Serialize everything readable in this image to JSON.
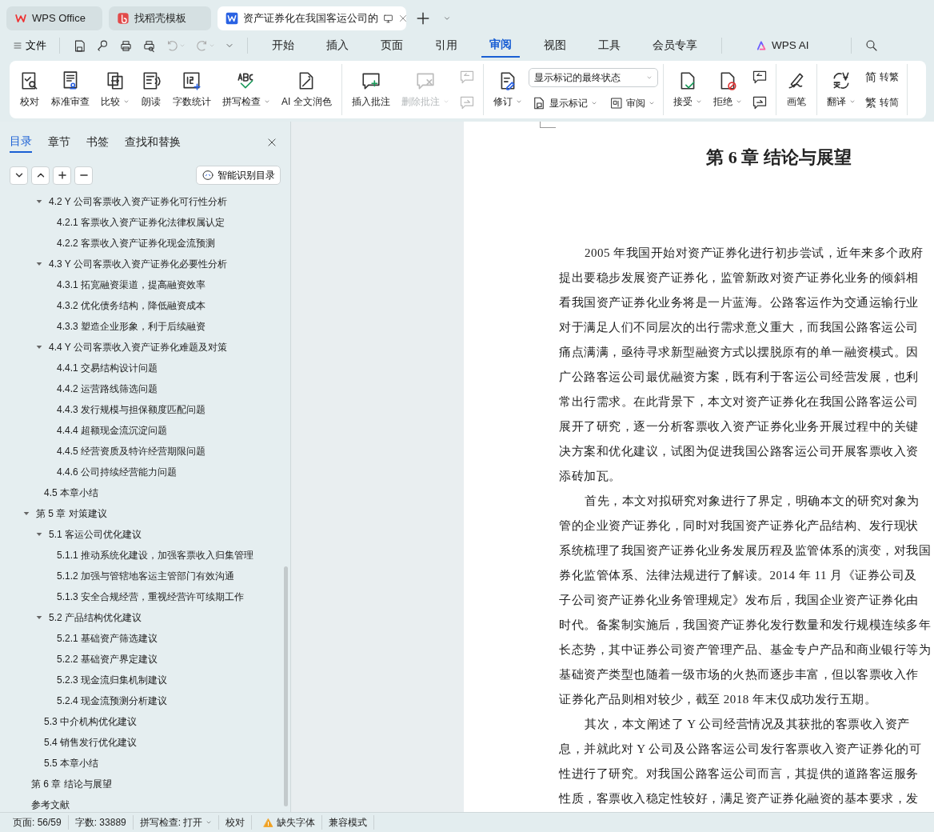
{
  "window_tabs": [
    {
      "label": "WPS Office",
      "selected": false
    },
    {
      "label": "找稻壳模板",
      "selected": false
    },
    {
      "label": "资产证券化在我国客运公司的",
      "selected": true
    }
  ],
  "menu": {
    "file": "文件",
    "tabs": [
      {
        "label": "开始",
        "selected": false
      },
      {
        "label": "插入",
        "selected": false
      },
      {
        "label": "页面",
        "selected": false
      },
      {
        "label": "引用",
        "selected": false
      },
      {
        "label": "审阅",
        "selected": true
      },
      {
        "label": "视图",
        "selected": false
      },
      {
        "label": "工具",
        "selected": false
      },
      {
        "label": "会员专享",
        "selected": false
      }
    ],
    "ai": "WPS AI"
  },
  "ribbon": {
    "groups": [
      {
        "items": [
          {
            "kind": "large",
            "label": "校对",
            "dropdown": false,
            "disabled": false
          },
          {
            "kind": "large",
            "label": "标准审查",
            "dropdown": false,
            "disabled": false
          },
          {
            "kind": "large",
            "label": "比较",
            "dropdown": true,
            "disabled": false
          },
          {
            "kind": "large",
            "label": "朗读",
            "dropdown": false,
            "disabled": false
          },
          {
            "kind": "large",
            "label": "字数统计",
            "dropdown": false,
            "disabled": false
          },
          {
            "kind": "large",
            "label": "拼写检查",
            "dropdown": true,
            "disabled": false
          },
          {
            "kind": "large",
            "label": "AI 全文润色",
            "dropdown": false,
            "disabled": false
          }
        ]
      },
      {
        "items": [
          {
            "kind": "large",
            "label": "插入批注",
            "dropdown": false,
            "disabled": false
          },
          {
            "kind": "large",
            "label": "删除批注",
            "dropdown": true,
            "disabled": true
          },
          {
            "kind": "pair",
            "disabled": true
          }
        ]
      },
      {
        "items": [
          {
            "kind": "large",
            "label": "修订",
            "dropdown": true,
            "disabled": false
          },
          {
            "kind": "review",
            "select": "显示标记的最终状态",
            "buttons": [
              {
                "label": "显示标记",
                "dropdown": true
              },
              {
                "label": "审阅",
                "dropdown": true
              }
            ]
          }
        ]
      },
      {
        "items": [
          {
            "kind": "large",
            "label": "接受",
            "dropdown": true,
            "disabled": false
          },
          {
            "kind": "large",
            "label": "拒绝",
            "dropdown": true,
            "disabled": false
          },
          {
            "kind": "pair",
            "disabled": false
          }
        ]
      },
      {
        "items": [
          {
            "kind": "large",
            "label": "画笔",
            "dropdown": false,
            "disabled": false
          }
        ]
      },
      {
        "items": [
          {
            "kind": "large",
            "label": "翻译",
            "dropdown": true,
            "disabled": false
          },
          {
            "kind": "convert",
            "buttons": [
              {
                "glyph": "简",
                "label": "转繁"
              },
              {
                "glyph": "繁",
                "label": "转简"
              }
            ]
          }
        ]
      }
    ]
  },
  "sidebar": {
    "tabs": [
      {
        "label": "目录",
        "selected": true
      },
      {
        "label": "章节",
        "selected": false
      },
      {
        "label": "书签",
        "selected": false
      },
      {
        "label": "查找和替换",
        "selected": false
      }
    ],
    "smart_button": "智能识别目录"
  },
  "outline": {
    "continued": [
      {
        "label": "4.2 Y 公司客票收入资产证券化可行性分析",
        "expanded": true,
        "children": [
          {
            "label": "4.2.1 客票收入资产证券化法律权属认定"
          },
          {
            "label": "4.2.2 客票收入资产证券化现金流预测"
          }
        ]
      },
      {
        "label": "4.3 Y 公司客票收入资产证券化必要性分析",
        "expanded": true,
        "children": [
          {
            "label": "4.3.1 拓宽融资渠道，提高融资效率"
          },
          {
            "label": "4.3.2 优化债务结构，降低融资成本"
          },
          {
            "label": "4.3.3 塑造企业形象，利于后续融资"
          }
        ]
      },
      {
        "label": "4.4 Y 公司客票收入资产证券化难题及对策",
        "expanded": true,
        "children": [
          {
            "label": "4.4.1 交易结构设计问题"
          },
          {
            "label": "4.4.2 运营路线筛选问题"
          },
          {
            "label": "4.4.3 发行规模与担保额度匹配问题"
          },
          {
            "label": "4.4.4 超额现金流沉淀问题"
          },
          {
            "label": "4.4.5 经营资质及特许经营期限问题"
          },
          {
            "label": "4.4.6 公司持续经营能力问题"
          }
        ]
      },
      {
        "label": "4.5 本章小结"
      }
    ],
    "items": [
      {
        "label": "第 5 章  对策建议",
        "expanded": true,
        "children": [
          {
            "label": "5.1  客运公司优化建议",
            "expanded": true,
            "children": [
              {
                "label": "5.1.1 推动系统化建设，加强客票收入归集管理"
              },
              {
                "label": "5.1.2 加强与管辖地客运主管部门有效沟通"
              },
              {
                "label": "5.1.3 安全合规经营，重视经营许可续期工作"
              }
            ]
          },
          {
            "label": "5.2  产品结构优化建议",
            "expanded": true,
            "children": [
              {
                "label": "5.2.1 基础资产筛选建议"
              },
              {
                "label": "5.2.2 基础资产界定建议"
              },
              {
                "label": "5.2.3 现金流归集机制建议"
              },
              {
                "label": "5.2.4 现金流预测分析建议"
              }
            ]
          },
          {
            "label": "5.3 中介机构优化建议"
          },
          {
            "label": "5.4 销售发行优化建议"
          },
          {
            "label": "5.5 本章小结"
          }
        ]
      },
      {
        "label": "第 6 章  结论与展望"
      },
      {
        "label": "参考文献"
      }
    ]
  },
  "document": {
    "title": "第 6 章  结论与展望",
    "paragraphs": [
      {
        "lines": [
          "2005 年我国开始对资产证券化进行初步尝试，近年来多个政府",
          "提出要稳步发展资产证券化，监管新政对资产证券化业务的倾斜相",
          "看我国资产证券化业务将是一片蓝海。公路客运作为交通运输行业",
          "对于满足人们不同层次的出行需求意义重大，而我国公路客运公司",
          "痛点满满，亟待寻求新型融资方式以摆脱原有的单一融资模式。因",
          "广公路客运公司最优融资方案，既有利于客运公司经营发展，也利",
          "常出行需求。在此背景下，本文对资产证券化在我国公路客运公司",
          "展开了研究，逐一分析客票收入资产证券化业务开展过程中的关键",
          "决方案和优化建议，试图为促进我国公路客运公司开展客票收入资",
          "添砖加瓦。"
        ]
      },
      {
        "lines": [
          "首先，本文对拟研究对象进行了界定，明确本文的研究对象为",
          "管的企业资产证券化，同时对我国资产证券化产品结构、发行现状",
          "系统梳理了我国资产证券化业务发展历程及监管体系的演变，对我国",
          "券化监管体系、法律法规进行了解读。2014 年 11 月《证券公司及",
          "子公司资产证券化业务管理规定》发布后，我国企业资产证券化由",
          "时代。备案制实施后，我国资产证券化发行数量和发行规模连续多年",
          "长态势，其中证券公司资产管理产品、基金专户产品和商业银行等为",
          "基础资产类型也随着一级市场的火热而逐步丰富，但以客票收入作",
          "证券化产品则相对较少，截至 2018 年末仅成功发行五期。"
        ]
      },
      {
        "lines": [
          "其次，本文阐述了 Y 公司经营情况及其获批的客票收入资产",
          "息，并就此对 Y 公司及公路客运公司发行客票收入资产证券化的可",
          "性进行了研究。对我国公路客运公司而言，其提供的道路客运服务",
          "性质，客票收入稳定性较好，满足资产证券化融资的基本要求，发"
        ]
      }
    ]
  },
  "status_bar": [
    {
      "kind": "text",
      "text": "页面: 56/59"
    },
    {
      "kind": "text",
      "text": "字数: 33889"
    },
    {
      "kind": "dropdown",
      "text": "拼写检查: 打开"
    },
    {
      "kind": "button",
      "text": "校对"
    },
    {
      "kind": "warning",
      "text": "缺失字体"
    },
    {
      "kind": "text",
      "text": "兼容模式"
    }
  ]
}
